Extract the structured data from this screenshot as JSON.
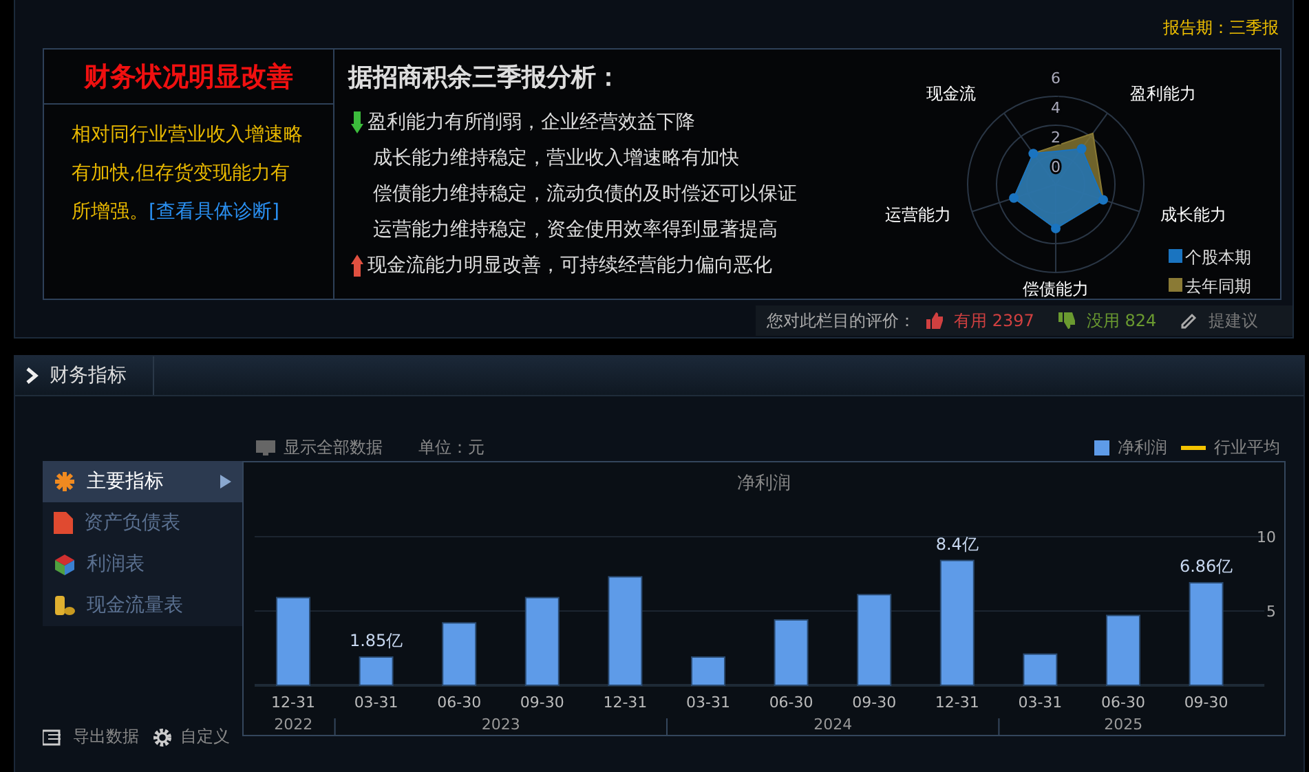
{
  "report_period": "报告期：三季报",
  "diagnosis": {
    "title": "财务状况明显改善",
    "text": "相对同行业营业收入增速略有加快,但存货变现能力有所增强。",
    "link": "[查看具体诊断]"
  },
  "analysis": {
    "title": "据招商积余三季报分析：",
    "lines": [
      {
        "kind": "down",
        "text": "盈利能力有所削弱，企业经营效益下降"
      },
      {
        "kind": "flat",
        "text": "成长能力维持稳定，营业收入增速略有加快"
      },
      {
        "kind": "flat",
        "text": "偿债能力维持稳定，流动负债的及时偿还可以保证"
      },
      {
        "kind": "flat",
        "text": "运营能力维持稳定，资金使用效率得到显著提高"
      },
      {
        "kind": "up",
        "text": "现金流能力明显改善，可持续经营能力偏向恶化"
      }
    ]
  },
  "radar": {
    "axes": [
      "盈利能力",
      "成长能力",
      "偿债能力",
      "运营能力",
      "现金流"
    ],
    "ticks": [
      "6",
      "4",
      "2",
      "0"
    ],
    "legend": [
      {
        "name": "个股本期",
        "color": "#1a74c0"
      },
      {
        "name": "去年同期",
        "color": "#8a7a35"
      }
    ]
  },
  "rating": {
    "prompt": "您对此栏目的评价：",
    "useful": {
      "label": "有用",
      "count": "2397"
    },
    "useless": {
      "label": "没用",
      "count": "824"
    },
    "suggest": "提建议"
  },
  "section": {
    "title": "财务指标"
  },
  "toolbar": {
    "show_all": "显示全部数据",
    "unit": "单位：元"
  },
  "menu": [
    {
      "kind": "main",
      "label": "主要指标",
      "selected": true
    },
    {
      "kind": "balance",
      "label": "资产负债表",
      "selected": false
    },
    {
      "kind": "income",
      "label": "利润表",
      "selected": false
    },
    {
      "kind": "cash",
      "label": "现金流量表",
      "selected": false
    }
  ],
  "chart_data": {
    "type": "bar",
    "title": "净利润",
    "categories": [
      "12-31",
      "03-31",
      "06-30",
      "09-30",
      "12-31",
      "03-31",
      "06-30",
      "09-30",
      "12-31",
      "03-31",
      "06-30",
      "09-30"
    ],
    "annotations": [
      "2022",
      "2023",
      "2024",
      "2025"
    ],
    "series": [
      {
        "name": "净利润",
        "color": "#5e9be8",
        "values": [
          5.9,
          1.9,
          4.2,
          5.9,
          7.3,
          1.9,
          4.4,
          6.1,
          8.4,
          2.1,
          4.7,
          6.9
        ]
      },
      {
        "name": "行业平均",
        "color": "#f5c400",
        "values": [
          null,
          null,
          null,
          null,
          null,
          null,
          null,
          null,
          null,
          null,
          null,
          null
        ]
      }
    ],
    "value_labels": [
      null,
      "1.85亿",
      null,
      null,
      null,
      null,
      null,
      null,
      "8.4亿",
      null,
      null,
      "6.86亿"
    ],
    "ylim": [
      0,
      10
    ],
    "yticks": [
      5,
      10
    ]
  },
  "footer": {
    "export": "导出数据",
    "customize": "自定义"
  }
}
